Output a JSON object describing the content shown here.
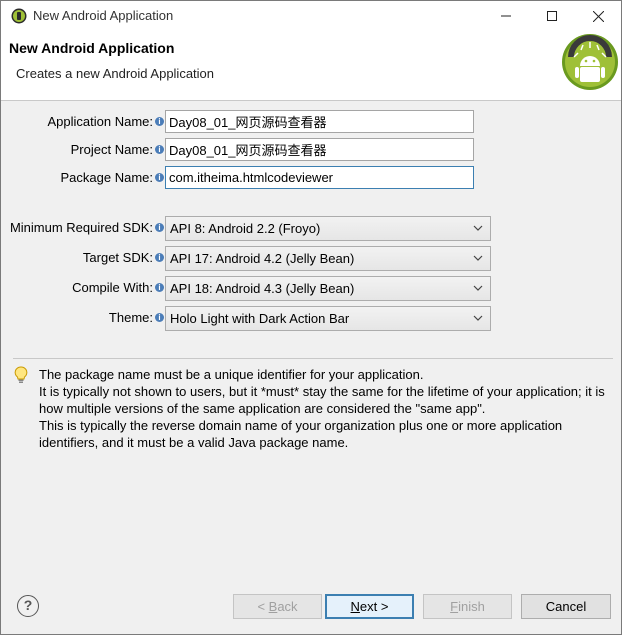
{
  "window": {
    "title": "New Android Application",
    "minimize_icon": "minimize-icon",
    "maximize_icon": "maximize-icon",
    "close_icon": "close-icon"
  },
  "banner": {
    "heading": "New Android Application",
    "subheading": "Creates a new Android Application",
    "logo_icon": "android-logo-icon"
  },
  "form": {
    "application_name": {
      "label": "Application Name:",
      "value": "Day08_01_网页源码查看器"
    },
    "project_name": {
      "label": "Project Name:",
      "value": "Day08_01_网页源码查看器"
    },
    "package_name": {
      "label": "Package Name:",
      "value": "com.itheima.htmlcodeviewer"
    },
    "min_sdk": {
      "label": "Minimum Required SDK:",
      "value": "API 8: Android 2.2 (Froyo)"
    },
    "target_sdk": {
      "label": "Target SDK:",
      "value": "API 17: Android 4.2 (Jelly Bean)"
    },
    "compile_with": {
      "label": "Compile With:",
      "value": "API 18: Android 4.3 (Jelly Bean)"
    },
    "theme": {
      "label": "Theme:",
      "value": "Holo Light with Dark Action Bar"
    }
  },
  "hint": {
    "icon": "lightbulb-icon",
    "line1": "The package name must be a unique identifier for your application.",
    "line2": "It is typically not shown to users, but it *must* stay the same for the lifetime of your application; it is how multiple versions of the same application are considered the \"same app\".",
    "line3": "This is typically the reverse domain name of your organization plus one or more application identifiers, and it must be a valid Java package name."
  },
  "buttons": {
    "help_icon": "help-icon",
    "back_prefix": "< ",
    "back_mnemonic": "B",
    "back_rest": "ack",
    "next_mnemonic": "N",
    "next_rest": "ext >",
    "finish_mnemonic": "F",
    "finish_rest": "inish",
    "cancel": "Cancel"
  },
  "colors": {
    "accent": "#3c7fb1",
    "android_green": "#9fc037",
    "info_blue": "#4b7db8"
  }
}
